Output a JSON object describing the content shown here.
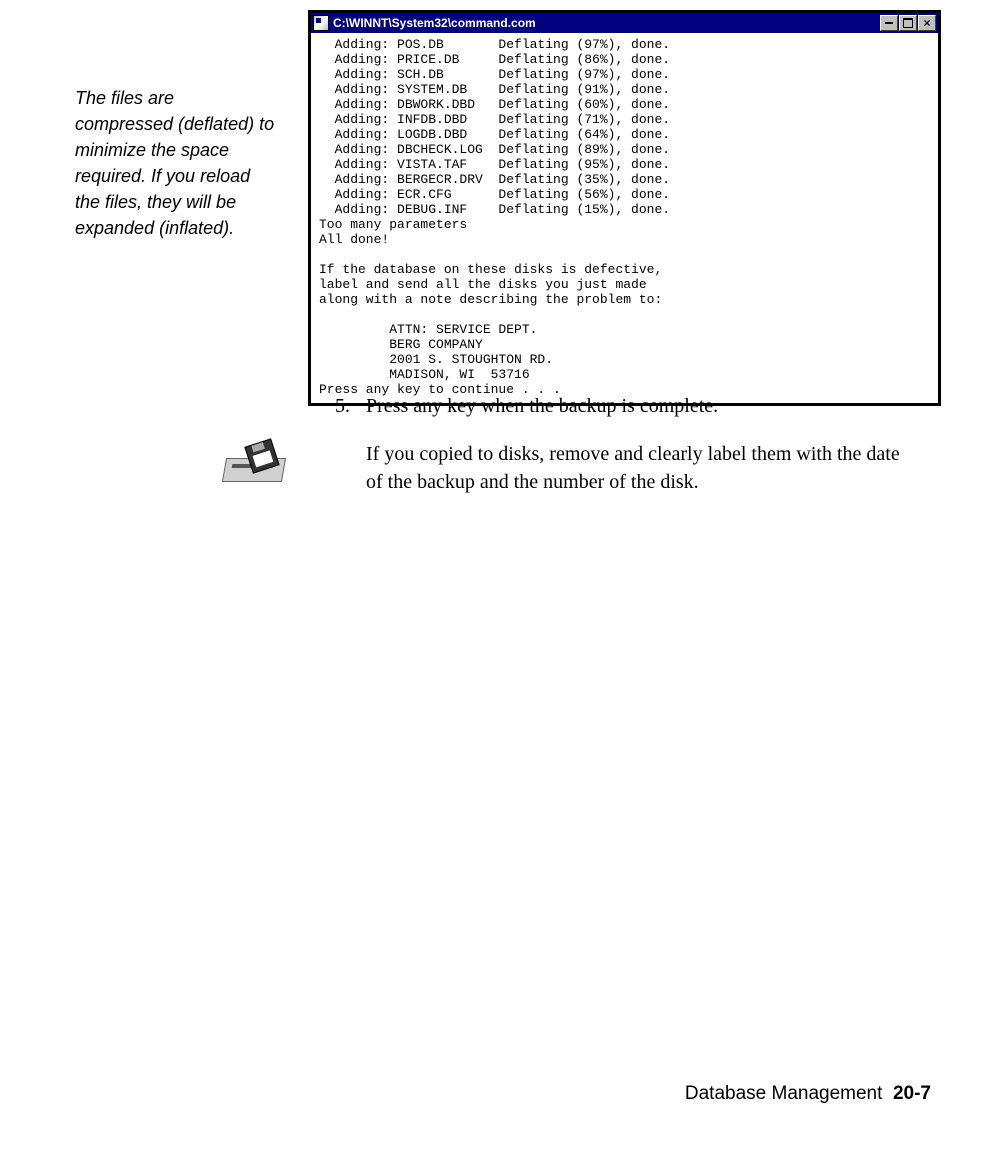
{
  "sidenote": "The files are compressed (deflated) to minimize the space required. If you reload the files, they will be expanded (inflated).",
  "console": {
    "title": "C:\\WINNT\\System32\\command.com",
    "lines": [
      "  Adding: POS.DB       Deflating (97%), done.",
      "  Adding: PRICE.DB     Deflating (86%), done.",
      "  Adding: SCH.DB       Deflating (97%), done.",
      "  Adding: SYSTEM.DB    Deflating (91%), done.",
      "  Adding: DBWORK.DBD   Deflating (60%), done.",
      "  Adding: INFDB.DBD    Deflating (71%), done.",
      "  Adding: LOGDB.DBD    Deflating (64%), done.",
      "  Adding: DBCHECK.LOG  Deflating (89%), done.",
      "  Adding: VISTA.TAF    Deflating (95%), done.",
      "  Adding: BERGECR.DRV  Deflating (35%), done.",
      "  Adding: ECR.CFG      Deflating (56%), done.",
      "  Adding: DEBUG.INF    Deflating (15%), done.",
      "Too many parameters",
      "All done!",
      "",
      "If the database on these disks is defective,",
      "label and send all the disks you just made",
      "along with a note describing the problem to:",
      "",
      "         ATTN: SERVICE DEPT.",
      "         BERG COMPANY",
      "         2001 S. STOUGHTON RD.",
      "         MADISON, WI  53716",
      "Press any key to continue . . ."
    ]
  },
  "step": {
    "number": "5.",
    "text": "Press any key when the backup is complete.",
    "subtext": "If you copied to  disks, remove and clearly label them with the date of the backup and the number of the disk."
  },
  "footer": {
    "section": "Database Management",
    "page": "20-7"
  }
}
